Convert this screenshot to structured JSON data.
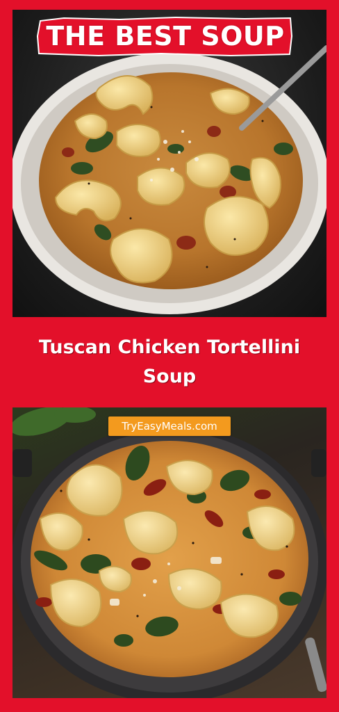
{
  "badge": {
    "text": "THE BEST SOUP"
  },
  "title": {
    "text": "Tuscan Chicken Tortellini Soup"
  },
  "watermark": {
    "text": "TryEasyMeals.com"
  },
  "colors": {
    "background": "#e3102a",
    "badge_fill": "#e3102a",
    "watermark_fill": "#f39a1e",
    "text": "#ffffff"
  },
  "images": [
    {
      "name": "top-soup-photo",
      "depicts": "white bowl of creamy tortellini soup with spinach, tomatoes and parmesan, spoon"
    },
    {
      "name": "bottom-soup-photo",
      "depicts": "dark pot of creamy tortellini soup with spinach and sun-dried tomatoes"
    }
  ]
}
